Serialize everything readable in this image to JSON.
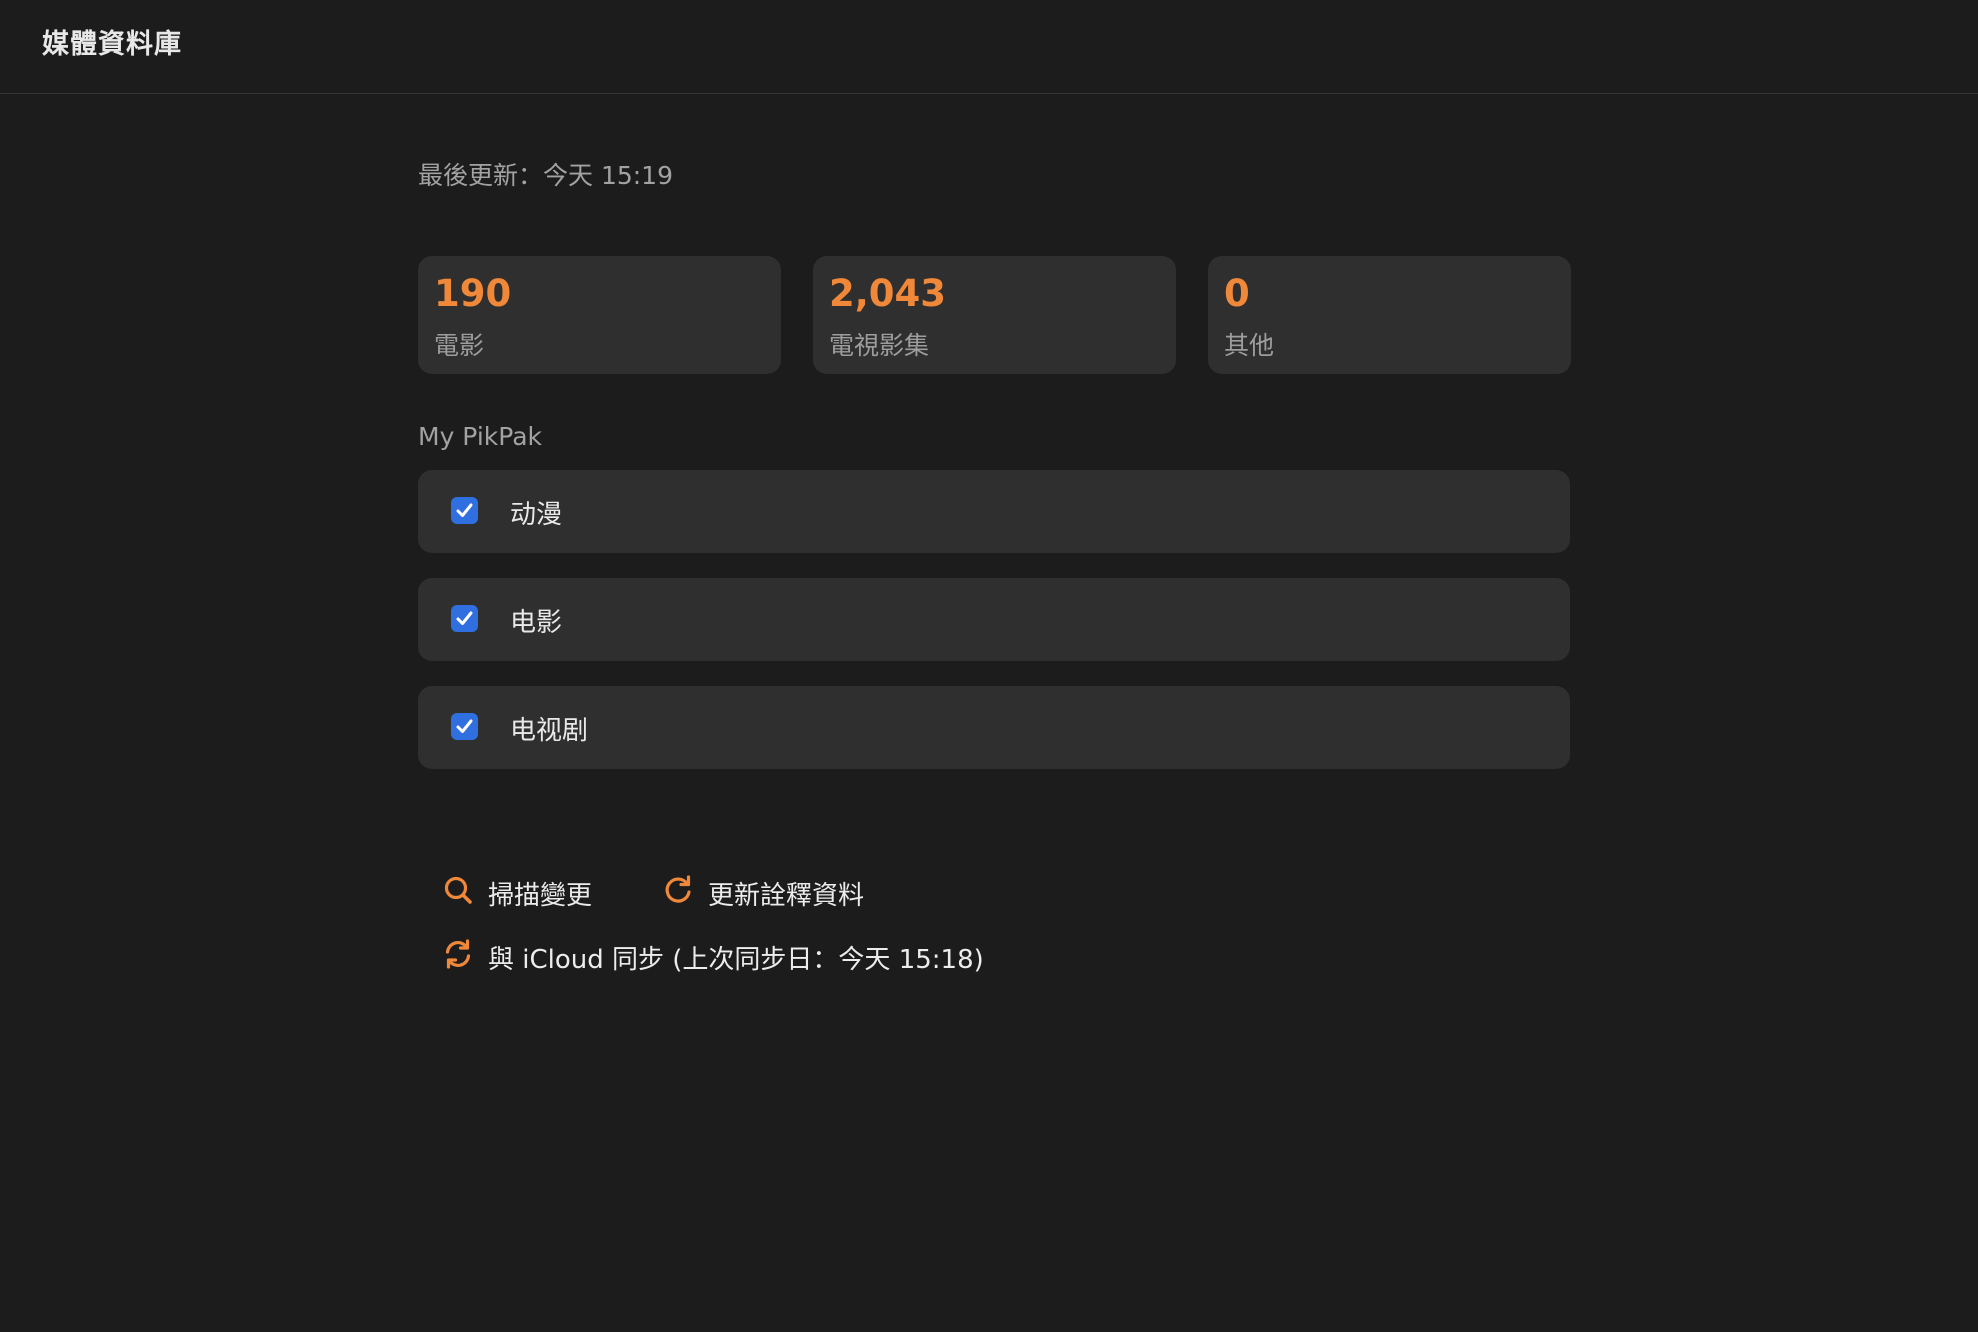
{
  "header": {
    "title": "媒體資料庫"
  },
  "library": {
    "last_updated": "最後更新：今天 15:19",
    "stats": [
      {
        "value": "190",
        "label": "電影"
      },
      {
        "value": "2,043",
        "label": "電視影集"
      },
      {
        "value": "0",
        "label": "其他"
      }
    ],
    "source_name": "My PikPak",
    "folders": [
      {
        "label": "动漫",
        "checked": true
      },
      {
        "label": "电影",
        "checked": true
      },
      {
        "label": "电视剧",
        "checked": true
      }
    ]
  },
  "actions": {
    "scan_label": "掃描變更",
    "refresh_metadata_label": "更新詮釋資料",
    "icloud_sync_label": "與 iCloud 同步 (上次同步日：今天 15:18)"
  },
  "icons": {
    "scan": "search-icon",
    "refresh": "refresh-icon",
    "sync": "sync-icon",
    "checkbox": "checkmark-icon"
  },
  "colors": {
    "accent": "#f0883a",
    "checkbox": "#2f6fe0",
    "background": "#1c1c1c",
    "card": "#2f2f2f"
  }
}
